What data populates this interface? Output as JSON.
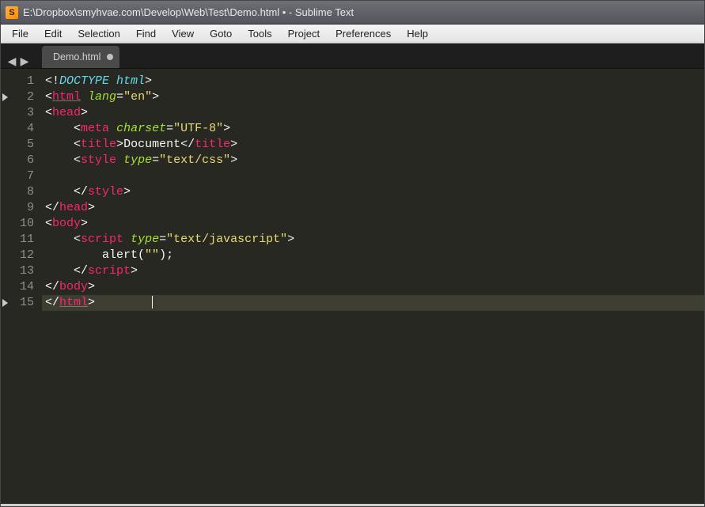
{
  "titlebar": {
    "app_glyph": "S",
    "title": "E:\\Dropbox\\smyhvae.com\\Develop\\Web\\Test\\Demo.html • - Sublime Text"
  },
  "menubar": {
    "items": [
      "File",
      "Edit",
      "Selection",
      "Find",
      "View",
      "Goto",
      "Tools",
      "Project",
      "Preferences",
      "Help"
    ]
  },
  "tabs": {
    "arrows": {
      "back": "◀",
      "forward": "▶"
    },
    "open": [
      {
        "label": "Demo.html",
        "active": true,
        "dirty": true
      }
    ]
  },
  "gutter": {
    "lines": [
      {
        "n": "1",
        "marked": false
      },
      {
        "n": "2",
        "marked": true
      },
      {
        "n": "3",
        "marked": false
      },
      {
        "n": "4",
        "marked": false
      },
      {
        "n": "5",
        "marked": false
      },
      {
        "n": "6",
        "marked": false
      },
      {
        "n": "7",
        "marked": false
      },
      {
        "n": "8",
        "marked": false
      },
      {
        "n": "9",
        "marked": false
      },
      {
        "n": "10",
        "marked": false
      },
      {
        "n": "11",
        "marked": false
      },
      {
        "n": "12",
        "marked": false
      },
      {
        "n": "13",
        "marked": false
      },
      {
        "n": "14",
        "marked": false
      },
      {
        "n": "15",
        "marked": true
      }
    ]
  },
  "code": {
    "lines": [
      {
        "indent": 0,
        "tokens": [
          {
            "t": "<!",
            "c": "punc"
          },
          {
            "t": "DOCTYPE html",
            "c": "doctype"
          },
          {
            "t": ">",
            "c": "punc"
          }
        ]
      },
      {
        "indent": 0,
        "tokens": [
          {
            "t": "<",
            "c": "punc"
          },
          {
            "t": "html",
            "c": "tag",
            "u": true
          },
          {
            "t": " ",
            "c": "punc"
          },
          {
            "t": "lang",
            "c": "attr"
          },
          {
            "t": "=",
            "c": "punc"
          },
          {
            "t": "\"en\"",
            "c": "str"
          },
          {
            "t": ">",
            "c": "punc"
          }
        ]
      },
      {
        "indent": 0,
        "tokens": [
          {
            "t": "<",
            "c": "punc"
          },
          {
            "t": "head",
            "c": "tag"
          },
          {
            "t": ">",
            "c": "punc"
          }
        ]
      },
      {
        "indent": 1,
        "tokens": [
          {
            "t": "<",
            "c": "punc"
          },
          {
            "t": "meta",
            "c": "tag"
          },
          {
            "t": " ",
            "c": "punc"
          },
          {
            "t": "charset",
            "c": "attr"
          },
          {
            "t": "=",
            "c": "punc"
          },
          {
            "t": "\"UTF-8\"",
            "c": "str"
          },
          {
            "t": ">",
            "c": "punc"
          }
        ]
      },
      {
        "indent": 1,
        "tokens": [
          {
            "t": "<",
            "c": "punc"
          },
          {
            "t": "title",
            "c": "tag"
          },
          {
            "t": ">",
            "c": "punc"
          },
          {
            "t": "Document",
            "c": "punc"
          },
          {
            "t": "</",
            "c": "punc"
          },
          {
            "t": "title",
            "c": "tag"
          },
          {
            "t": ">",
            "c": "punc"
          }
        ]
      },
      {
        "indent": 1,
        "tokens": [
          {
            "t": "<",
            "c": "punc"
          },
          {
            "t": "style",
            "c": "tag"
          },
          {
            "t": " ",
            "c": "punc"
          },
          {
            "t": "type",
            "c": "attr"
          },
          {
            "t": "=",
            "c": "punc"
          },
          {
            "t": "\"text/css\"",
            "c": "str"
          },
          {
            "t": ">",
            "c": "punc"
          }
        ]
      },
      {
        "indent": 0,
        "tokens": []
      },
      {
        "indent": 1,
        "tokens": [
          {
            "t": "</",
            "c": "punc"
          },
          {
            "t": "style",
            "c": "tag"
          },
          {
            "t": ">",
            "c": "punc"
          }
        ]
      },
      {
        "indent": 0,
        "tokens": [
          {
            "t": "</",
            "c": "punc"
          },
          {
            "t": "head",
            "c": "tag"
          },
          {
            "t": ">",
            "c": "punc"
          }
        ]
      },
      {
        "indent": 0,
        "tokens": [
          {
            "t": "<",
            "c": "punc"
          },
          {
            "t": "body",
            "c": "tag"
          },
          {
            "t": ">",
            "c": "punc"
          }
        ]
      },
      {
        "indent": 1,
        "tokens": [
          {
            "t": "<",
            "c": "punc"
          },
          {
            "t": "script",
            "c": "tag"
          },
          {
            "t": " ",
            "c": "punc"
          },
          {
            "t": "type",
            "c": "attr"
          },
          {
            "t": "=",
            "c": "punc"
          },
          {
            "t": "\"text/javascript\"",
            "c": "str"
          },
          {
            "t": ">",
            "c": "punc"
          }
        ]
      },
      {
        "indent": 2,
        "tokens": [
          {
            "t": "alert",
            "c": "punc"
          },
          {
            "t": "(",
            "c": "punc"
          },
          {
            "t": "\"\"",
            "c": "str"
          },
          {
            "t": ")",
            "c": "punc"
          },
          {
            "t": ";",
            "c": "punc"
          }
        ]
      },
      {
        "indent": 1,
        "tokens": [
          {
            "t": "</",
            "c": "punc"
          },
          {
            "t": "script",
            "c": "tag"
          },
          {
            "t": ">",
            "c": "punc"
          }
        ]
      },
      {
        "indent": 0,
        "tokens": [
          {
            "t": "</",
            "c": "punc"
          },
          {
            "t": "body",
            "c": "tag"
          },
          {
            "t": ">",
            "c": "punc"
          }
        ]
      },
      {
        "indent": 0,
        "cursor": true,
        "tokens": [
          {
            "t": "</",
            "c": "punc"
          },
          {
            "t": "html",
            "c": "tag",
            "u": true
          },
          {
            "t": ">",
            "c": "punc"
          }
        ]
      }
    ]
  }
}
